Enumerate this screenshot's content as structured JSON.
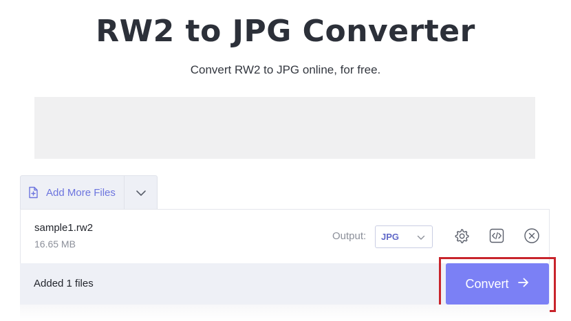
{
  "header": {
    "title": "RW2 to JPG Converter",
    "subtitle": "Convert RW2 to JPG online, for free."
  },
  "toolbar": {
    "add_files_label": "Add More Files",
    "add_files_icon": "file-plus-icon",
    "dropdown_icon": "chevron-down-icon"
  },
  "file": {
    "name": "sample1.rw2",
    "size": "16.65 MB",
    "output_label": "Output:",
    "output_value": "JPG",
    "actions": [
      "gear-icon",
      "code-icon",
      "close-circle-icon"
    ]
  },
  "footer": {
    "status": "Added 1 files",
    "convert_label": "Convert",
    "convert_icon": "arrow-right-icon"
  },
  "colors": {
    "accent": "#7b80f5",
    "link": "#6c74de",
    "highlight": "#c8242b",
    "panel_bg": "#eef0f6"
  }
}
